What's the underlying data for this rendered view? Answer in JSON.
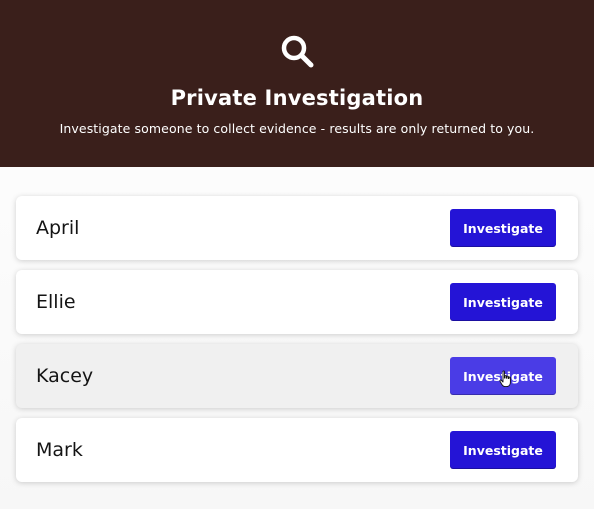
{
  "header": {
    "icon": "search-icon",
    "title": "Private Investigation",
    "subtitle": "Investigate someone to collect evidence - results are only returned to you."
  },
  "players": [
    {
      "name": "April",
      "button_label": "Investigate"
    },
    {
      "name": "Ellie",
      "button_label": "Investigate"
    },
    {
      "name": "Kacey",
      "button_label": "Investigate",
      "hovered": true
    },
    {
      "name": "Mark",
      "button_label": "Investigate"
    }
  ],
  "colors": {
    "header_bg": "#3a1f1b",
    "button": "#2414d6",
    "button_hover": "#4a3ce6"
  }
}
